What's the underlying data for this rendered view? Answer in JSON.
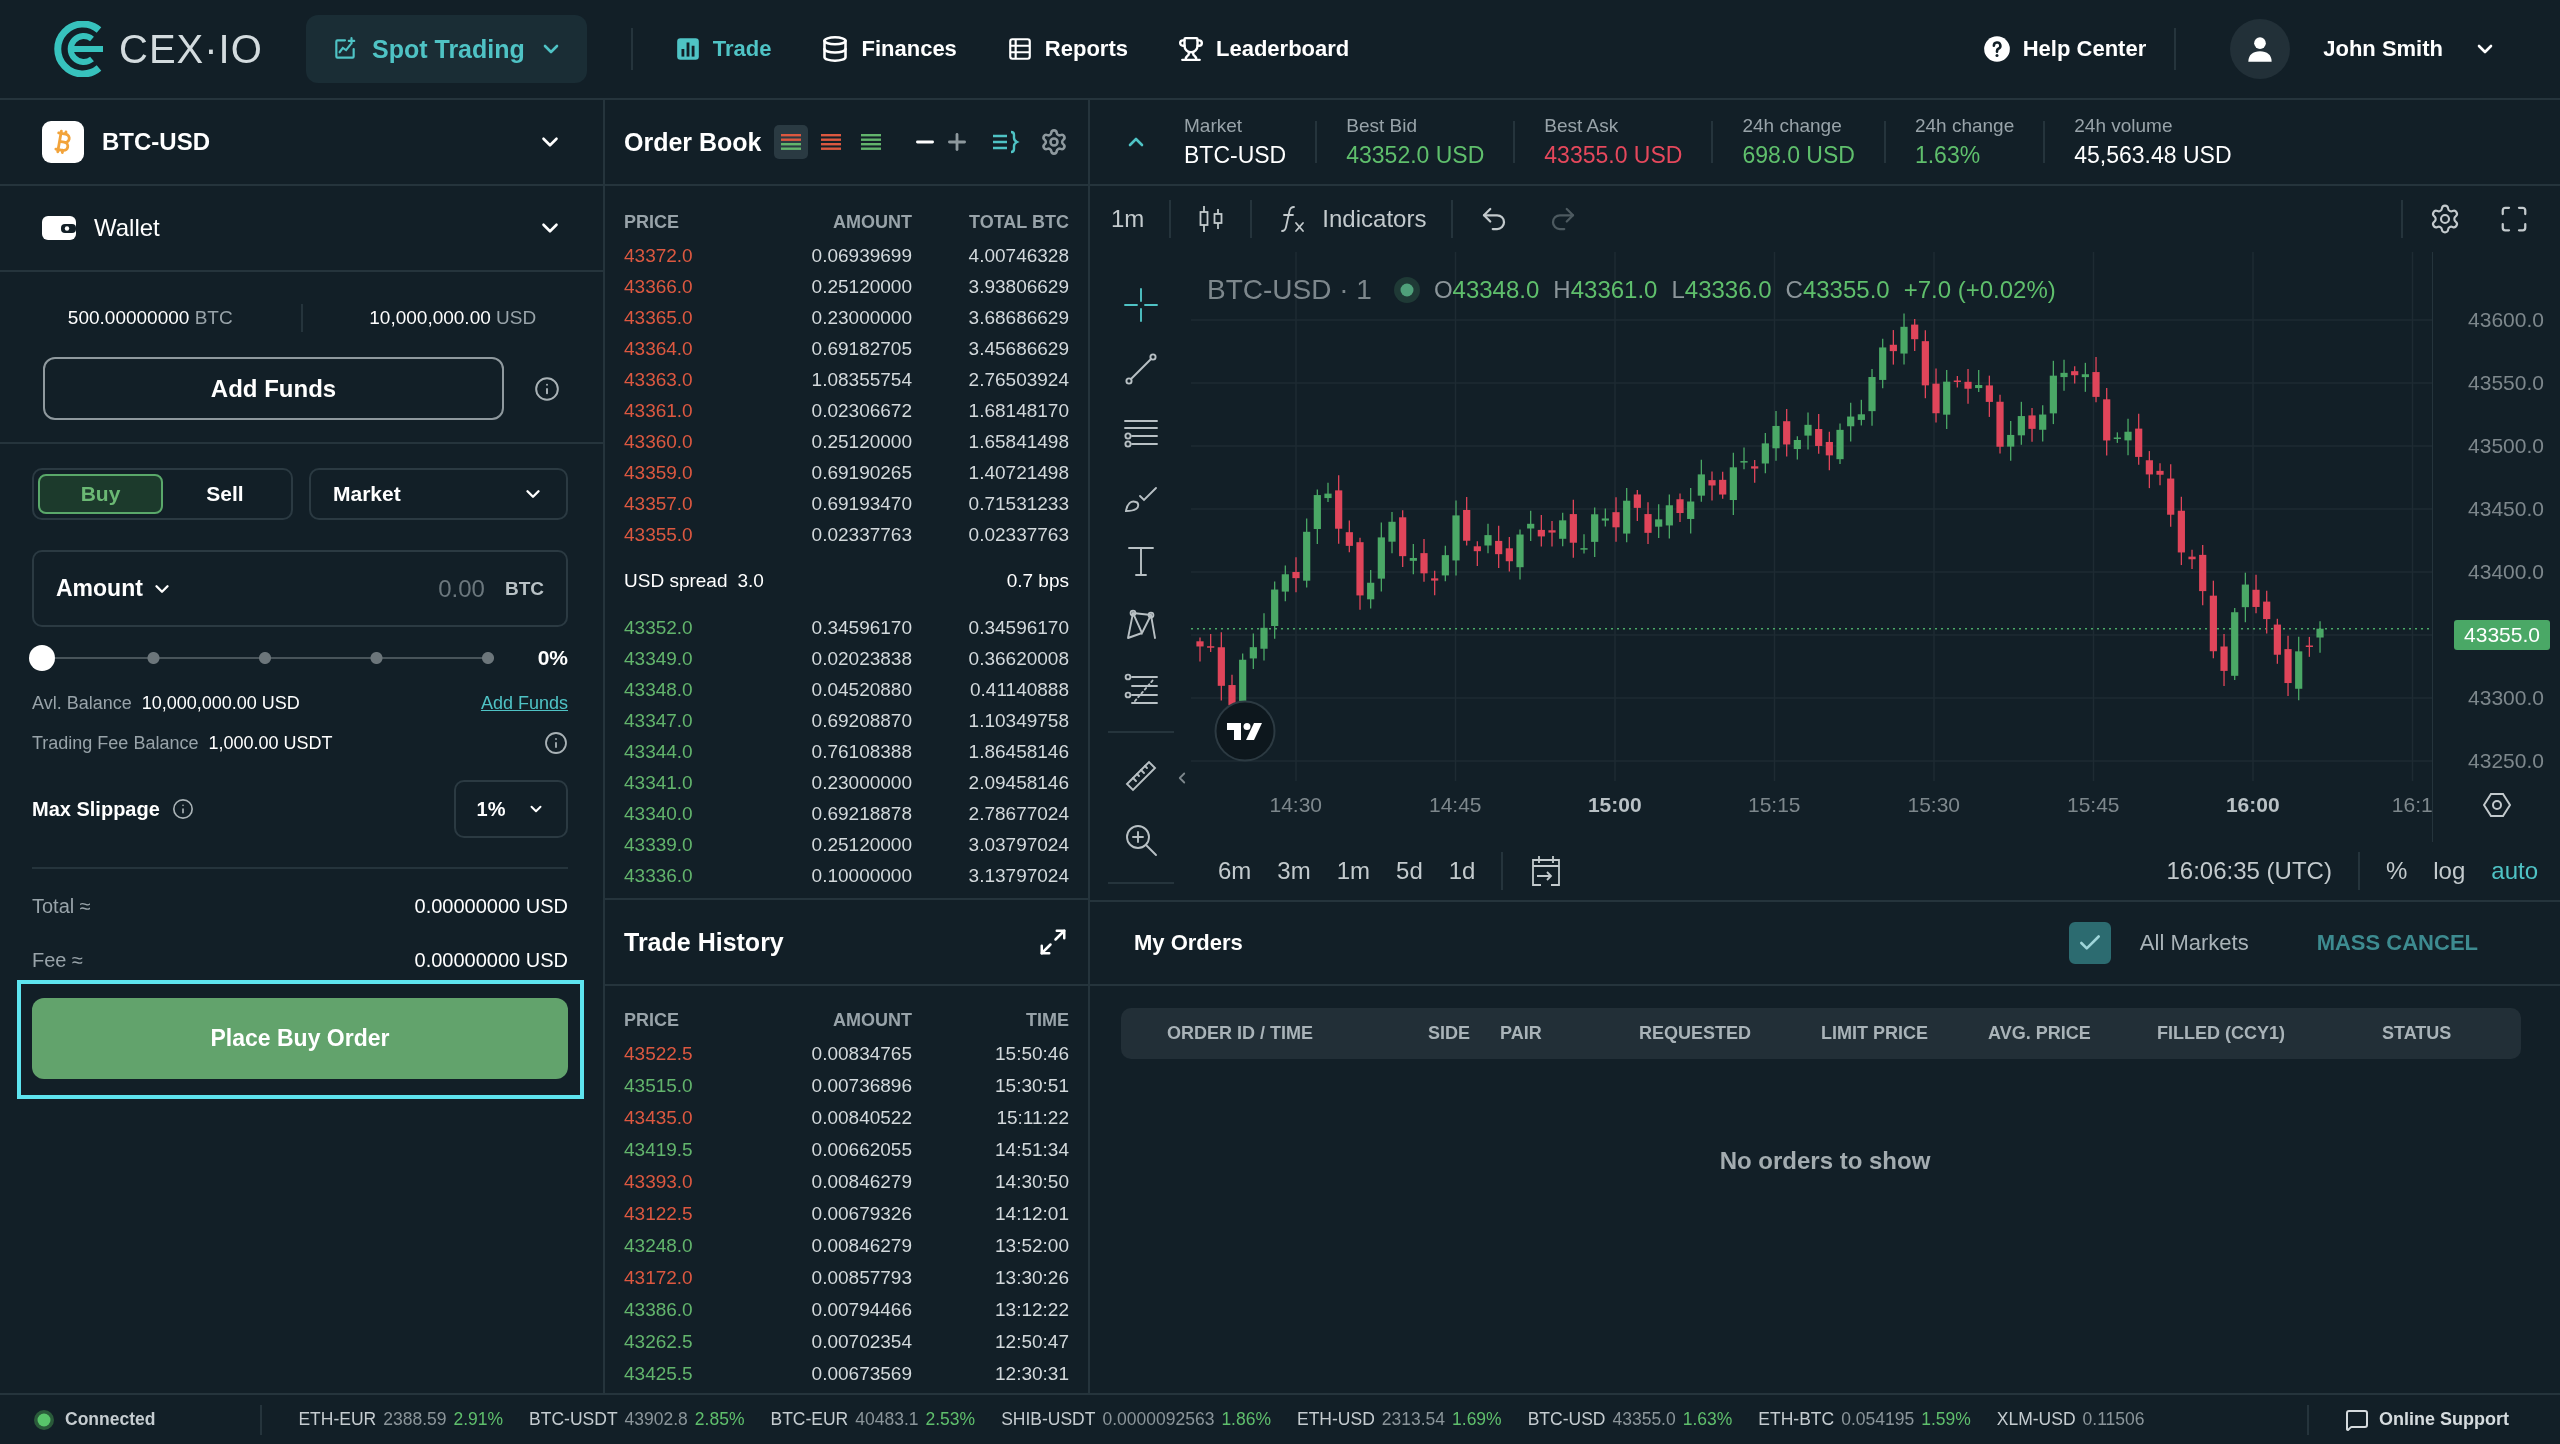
{
  "header": {
    "brand": "CEX·IO",
    "product": "Spot Trading",
    "nav": [
      {
        "label": "Trade",
        "kind": "trade",
        "selected": true
      },
      {
        "label": "Finances",
        "kind": "finances",
        "selected": false
      },
      {
        "label": "Reports",
        "kind": "reports",
        "selected": false
      },
      {
        "label": "Leaderboard",
        "kind": "leaderboard",
        "selected": false
      }
    ],
    "help": "Help Center",
    "user": "John Smith"
  },
  "pair_selector": {
    "pair": "BTC-USD"
  },
  "wallet": {
    "title": "Wallet",
    "balances": [
      {
        "amount": "500.00000000",
        "currency": "BTC"
      },
      {
        "amount": "10,000,000.00",
        "currency": "USD"
      }
    ],
    "add_funds": "Add Funds"
  },
  "order_form": {
    "sides": [
      {
        "label": "Buy",
        "selected": true
      },
      {
        "label": "Sell",
        "selected": false
      }
    ],
    "order_type": "Market",
    "amount": {
      "label": "Amount",
      "placeholder": "0.00",
      "currency": "BTC"
    },
    "slider": {
      "level": 0,
      "reading": "0%"
    },
    "available_balance": {
      "label": "Avl. Balance",
      "value": "10,000,000.00 USD",
      "link": "Add Funds"
    },
    "fee_balance": {
      "label": "Trading Fee Balance",
      "value": "1,000.00 USDT"
    },
    "max_slippage": {
      "label": "Max Slippage",
      "value": "1%"
    },
    "totals": [
      {
        "label": "Total ≈",
        "value": "0.00000000 USD"
      },
      {
        "label": "Fee ≈",
        "value": "0.00000000 USD"
      }
    ],
    "submit": {
      "label": "Place Buy Order",
      "highlighted": true
    }
  },
  "order_book": {
    "title": "Order Book",
    "views": [
      {
        "kind": "both",
        "selected": true
      },
      {
        "kind": "asks",
        "selected": false
      },
      {
        "kind": "bids",
        "selected": false
      }
    ],
    "columns": [
      "PRICE",
      "AMOUNT",
      "TOTAL BTC"
    ],
    "asks": [
      {
        "price": "43372.0",
        "amount": "0.06939699",
        "total": "4.00746328"
      },
      {
        "price": "43366.0",
        "amount": "0.25120000",
        "total": "3.93806629"
      },
      {
        "price": "43365.0",
        "amount": "0.23000000",
        "total": "3.68686629"
      },
      {
        "price": "43364.0",
        "amount": "0.69182705",
        "total": "3.45686629"
      },
      {
        "price": "43363.0",
        "amount": "1.08355754",
        "total": "2.76503924"
      },
      {
        "price": "43361.0",
        "amount": "0.02306672",
        "total": "1.68148170"
      },
      {
        "price": "43360.0",
        "amount": "0.25120000",
        "total": "1.65841498"
      },
      {
        "price": "43359.0",
        "amount": "0.69190265",
        "total": "1.40721498"
      },
      {
        "price": "43357.0",
        "amount": "0.69193470",
        "total": "0.71531233"
      },
      {
        "price": "43355.0",
        "amount": "0.02337763",
        "total": "0.02337763"
      }
    ],
    "spread": {
      "label": "USD spread",
      "value": "3.0",
      "bps": "0.7 bps"
    },
    "bids": [
      {
        "price": "43352.0",
        "amount": "0.34596170",
        "total": "0.34596170"
      },
      {
        "price": "43349.0",
        "amount": "0.02023838",
        "total": "0.36620008"
      },
      {
        "price": "43348.0",
        "amount": "0.04520880",
        "total": "0.41140888"
      },
      {
        "price": "43347.0",
        "amount": "0.69208870",
        "total": "1.10349758"
      },
      {
        "price": "43344.0",
        "amount": "0.76108388",
        "total": "1.86458146"
      },
      {
        "price": "43341.0",
        "amount": "0.23000000",
        "total": "2.09458146"
      },
      {
        "price": "43340.0",
        "amount": "0.69218878",
        "total": "2.78677024"
      },
      {
        "price": "43339.0",
        "amount": "0.25120000",
        "total": "3.03797024"
      },
      {
        "price": "43336.0",
        "amount": "0.10000000",
        "total": "3.13797024"
      }
    ]
  },
  "trade_history": {
    "title": "Trade History",
    "columns": [
      "PRICE",
      "AMOUNT",
      "TIME"
    ],
    "rows": [
      {
        "price": "43522.5",
        "amount": "0.00834765",
        "time": "15:50:46",
        "color": "#dc5840"
      },
      {
        "price": "43515.0",
        "amount": "0.00736896",
        "time": "15:30:51",
        "color": "#62b46c"
      },
      {
        "price": "43435.0",
        "amount": "0.00840522",
        "time": "15:11:22",
        "color": "#dc5840"
      },
      {
        "price": "43419.5",
        "amount": "0.00662055",
        "time": "14:51:34",
        "color": "#62b46c"
      },
      {
        "price": "43393.0",
        "amount": "0.00846279",
        "time": "14:30:50",
        "color": "#dc5840"
      },
      {
        "price": "43122.5",
        "amount": "0.00679326",
        "time": "14:12:01",
        "color": "#dc5840"
      },
      {
        "price": "43248.0",
        "amount": "0.00846279",
        "time": "13:52:00",
        "color": "#62b46c"
      },
      {
        "price": "43172.0",
        "amount": "0.00857793",
        "time": "13:30:26",
        "color": "#dc5840"
      },
      {
        "price": "43386.0",
        "amount": "0.00794466",
        "time": "13:12:22",
        "color": "#62b46c"
      },
      {
        "price": "43262.5",
        "amount": "0.00702354",
        "time": "12:50:47",
        "color": "#62b46c"
      },
      {
        "price": "43425.5",
        "amount": "0.00673569",
        "time": "12:30:31",
        "color": "#62b46c"
      }
    ]
  },
  "market_stats": {
    "items": [
      {
        "label": "Market",
        "value": "BTC-USD",
        "color": "#ffffff"
      },
      {
        "label": "Best Bid",
        "value": "43352.0 USD",
        "color": "#5fbf6c"
      },
      {
        "label": "Best Ask",
        "value": "43355.0 USD",
        "color": "#e5485c"
      },
      {
        "label": "24h change",
        "value": "698.0 USD",
        "color": "#5fbf6c"
      },
      {
        "label": "24h change",
        "value": "1.63%",
        "color": "#5fbf6c"
      },
      {
        "label": "24h volume",
        "value": "45,563.48 USD",
        "color": "#ffffff"
      }
    ]
  },
  "chart": {
    "interval": "1m",
    "indicators": "Indicators",
    "undo": {
      "disabled": false
    },
    "redo": {
      "disabled": true
    },
    "tool_groups": [
      [
        {
          "kind": "crosshair",
          "selected": true
        },
        {
          "kind": "trend-line",
          "selected": false
        },
        {
          "kind": "horizontal-lines",
          "selected": false
        },
        {
          "kind": "brush",
          "selected": false
        },
        {
          "kind": "text",
          "selected": false
        },
        {
          "kind": "pattern",
          "selected": false
        },
        {
          "kind": "forecast",
          "selected": false
        }
      ],
      [
        {
          "kind": "ruler",
          "selected": false
        },
        {
          "kind": "zoom-in",
          "selected": false
        }
      ]
    ],
    "legend": {
      "symbol": "BTC-USD · 1",
      "ohlc": [
        {
          "label": "O",
          "value": "43348.0"
        },
        {
          "label": "H",
          "value": "43361.0"
        },
        {
          "label": "L",
          "value": "43336.0"
        },
        {
          "label": "C",
          "value": "43355.0"
        }
      ],
      "change": "+7.0 (+0.02%)"
    },
    "price_axis": [
      {
        "label": "43600.0",
        "kind": "tick"
      },
      {
        "label": "43550.0",
        "kind": "tick"
      },
      {
        "label": "43500.0",
        "kind": "tick"
      },
      {
        "label": "43450.0",
        "kind": "tick"
      },
      {
        "label": "43400.0",
        "kind": "tick"
      },
      {
        "label": "43355.0",
        "kind": "last"
      },
      {
        "label": "43300.0",
        "kind": "tick"
      },
      {
        "label": "43250.0",
        "kind": "tick"
      }
    ],
    "time_axis": [
      {
        "label": "14:30",
        "major": false
      },
      {
        "label": "14:45",
        "major": false
      },
      {
        "label": "15:00",
        "major": true
      },
      {
        "label": "15:15",
        "major": false
      },
      {
        "label": "15:30",
        "major": false
      },
      {
        "label": "15:45",
        "major": false
      },
      {
        "label": "16:00",
        "major": true
      },
      {
        "label": "16:1",
        "major": false
      }
    ],
    "ranges": [
      "6m",
      "3m",
      "1m",
      "5d",
      "1d"
    ],
    "clock": "16:06:35 (UTC)",
    "scales": [
      {
        "label": "%",
        "selected": false
      },
      {
        "label": "log",
        "selected": false
      },
      {
        "label": "auto",
        "selected": true
      }
    ]
  },
  "my_orders": {
    "title": "My Orders",
    "all_markets": {
      "label": "All Markets",
      "checked": true
    },
    "mass_cancel": "MASS CANCEL",
    "columns": [
      "ORDER ID / TIME",
      "SIDE",
      "PAIR",
      "REQUESTED",
      "LIMIT PRICE",
      "AVG. PRICE",
      "FILLED (CCY1)",
      "STATUS"
    ],
    "empty_message": "No orders to show"
  },
  "status_bar": {
    "connection": {
      "label": "Connected",
      "connected": true
    },
    "tickers": [
      {
        "pair": "ETH-EUR",
        "price": "2388.59",
        "change": "2.91%"
      },
      {
        "pair": "BTC-USDT",
        "price": "43902.8",
        "change": "2.85%"
      },
      {
        "pair": "BTC-EUR",
        "price": "40483.1",
        "change": "2.53%"
      },
      {
        "pair": "SHIB-USDT",
        "price": "0.0000092563",
        "change": "1.86%"
      },
      {
        "pair": "ETH-USD",
        "price": "2313.54",
        "change": "1.69%"
      },
      {
        "pair": "BTC-USD",
        "price": "43355.0",
        "change": "1.63%"
      },
      {
        "pair": "ETH-BTC",
        "price": "0.054195",
        "change": "1.59%"
      },
      {
        "pair": "XLM-USD",
        "price": "0.11506"
      }
    ],
    "support": "Online Support"
  }
}
